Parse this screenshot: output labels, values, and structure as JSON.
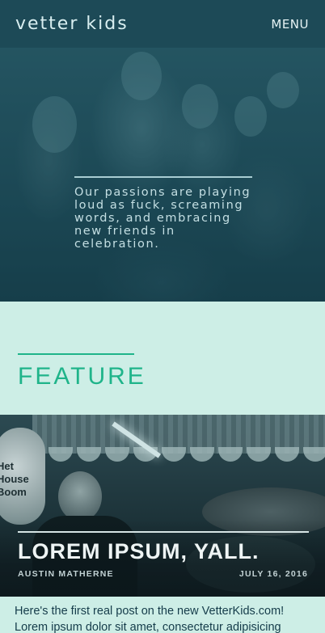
{
  "header": {
    "logo": "vetter kids",
    "menu_label": "MENU"
  },
  "hero": {
    "tagline": "Our passions are playing loud as fuck, screaming words, and embracing new friends in celebration."
  },
  "feature": {
    "heading": "FEATURE"
  },
  "post": {
    "title": "LOREM IPSUM, YALL.",
    "author": "AUSTIN MATHERNE",
    "date": "JULY 16, 2016",
    "excerpt_line1": "Here's the first real post on the new VetterKids.com!",
    "excerpt_line2": "Lorem ipsum dolor sit amet, consectetur adipisicing",
    "image_sign": "Het House Boom"
  },
  "colors": {
    "header_bg": "#1d4a57",
    "page_bg": "#cdeee6",
    "accent_green": "#1fb48a",
    "text_dark": "#153c4a"
  }
}
